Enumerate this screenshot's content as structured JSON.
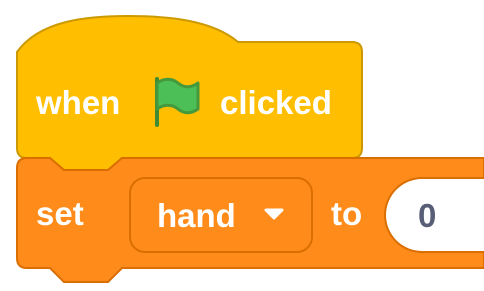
{
  "hat_block": {
    "when_label": "when",
    "flag_icon": "green-flag-icon",
    "clicked_label": "clicked",
    "color": "#ffbf00",
    "border_color": "#cc9900"
  },
  "set_block": {
    "set_label": "set",
    "variable": "hand",
    "caret_icon": "dropdown-caret-icon",
    "to_label": "to",
    "value": "0",
    "color": "#ff8c1a",
    "border_color": "#db6e00"
  }
}
